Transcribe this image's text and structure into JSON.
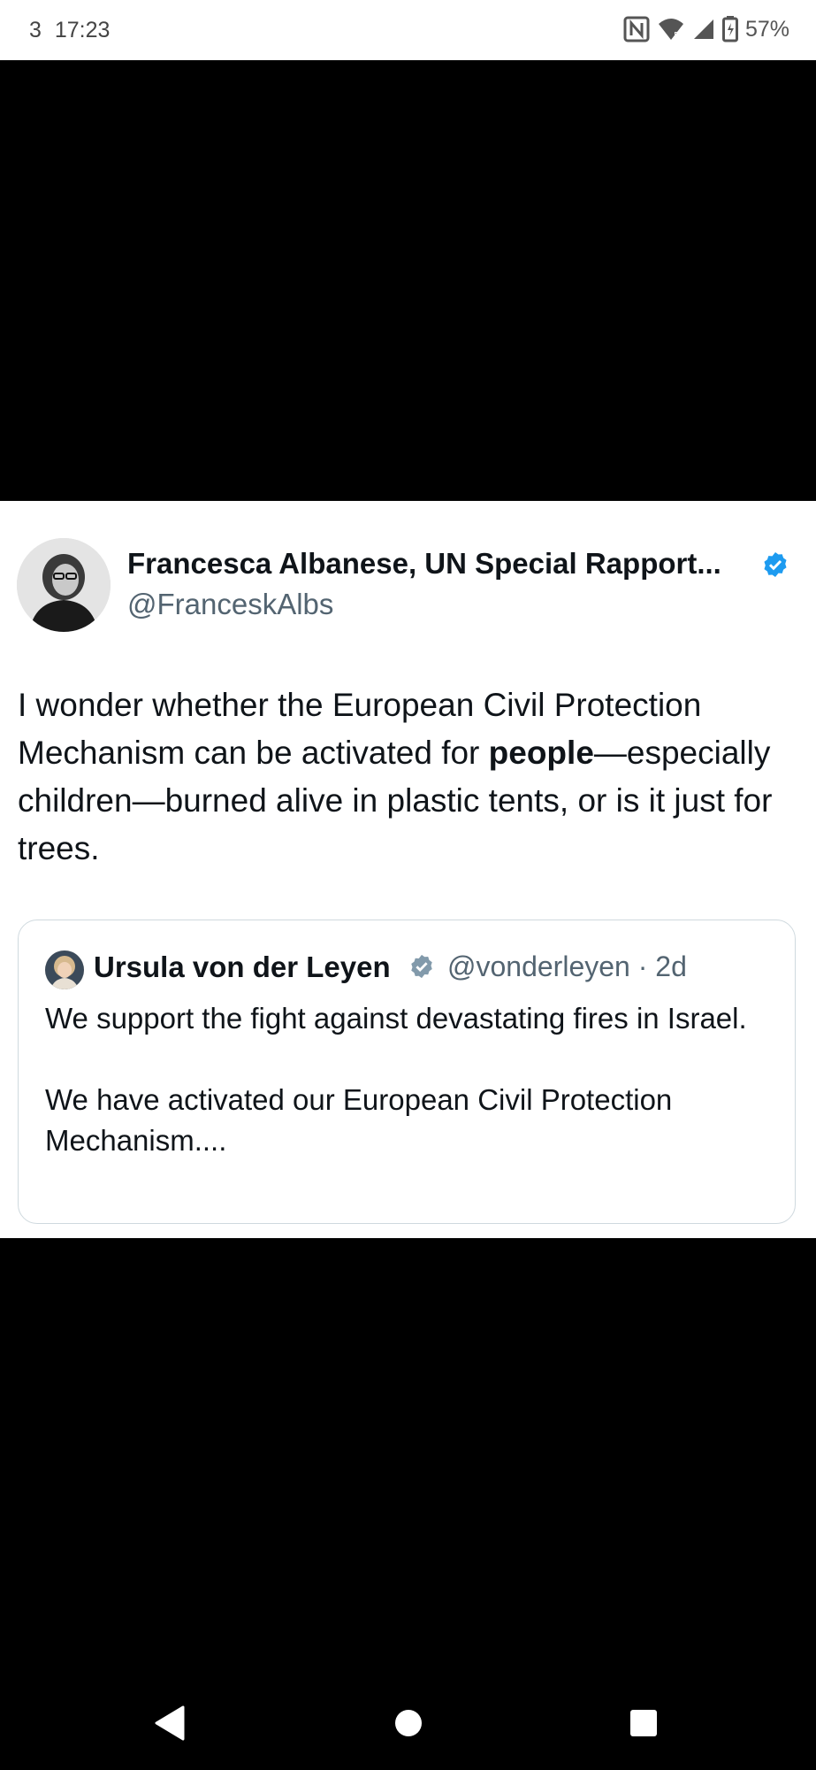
{
  "status_bar": {
    "notifications": "3",
    "time": "17:23",
    "battery": "57%",
    "icons": [
      "nfc-icon",
      "wifi-icon",
      "signal-icon",
      "battery-charging-icon"
    ]
  },
  "tweet": {
    "author_name": "Francesca Albanese, UN Special Rapport...",
    "handle": "@FranceskAlbs",
    "text_before_bold": "I wonder whether the European Civil Protection Mechanism can be activated for ",
    "text_bold": "people",
    "text_after_bold": "—especially children—burned alive in plastic tents, or is it just for trees.",
    "quote": {
      "author_name": "Ursula von der Leyen",
      "handle": "@vonderleyen · 2d",
      "paragraph_1": "We support the fight against devastating fires in Israel.",
      "paragraph_2": "We have activated our European Civil Protection Mechanism...."
    }
  },
  "colors": {
    "verified_blue": "#1d9bf0",
    "verified_gray": "#829aab",
    "secondary_text": "#536471",
    "primary_text": "#0f1419"
  },
  "nav": {
    "icons": [
      "back-icon",
      "home-icon",
      "recents-icon"
    ]
  }
}
